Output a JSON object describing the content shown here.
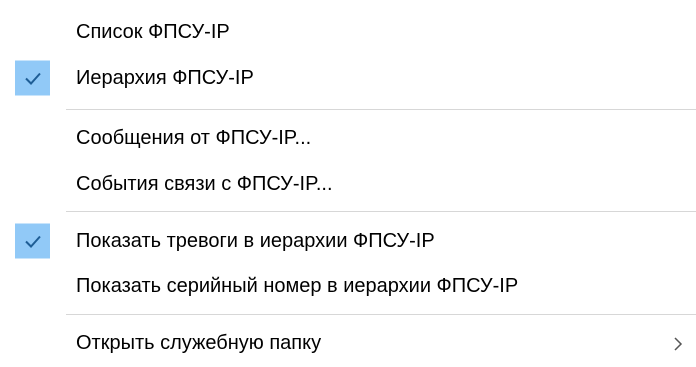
{
  "menu": {
    "items": [
      {
        "label": "Список ФПСУ-IP",
        "checked": false
      },
      {
        "label": "Иерархия ФПСУ-IP",
        "checked": true
      },
      {
        "label": "Сообщения от ФПСУ-IP...",
        "checked": false
      },
      {
        "label": "События связи с ФПСУ-IP...",
        "checked": false
      },
      {
        "label": "Показать тревоги в иерархии ФПСУ-IP",
        "checked": true
      },
      {
        "label": "Показать серийный номер в иерархии ФПСУ-IP",
        "checked": false
      },
      {
        "label": "Открыть служебную папку",
        "checked": false,
        "submenu": true
      }
    ],
    "colors": {
      "check_background": "#91c9f7",
      "check_mark": "#1e5d95",
      "separator": "#d7d7d7"
    }
  }
}
